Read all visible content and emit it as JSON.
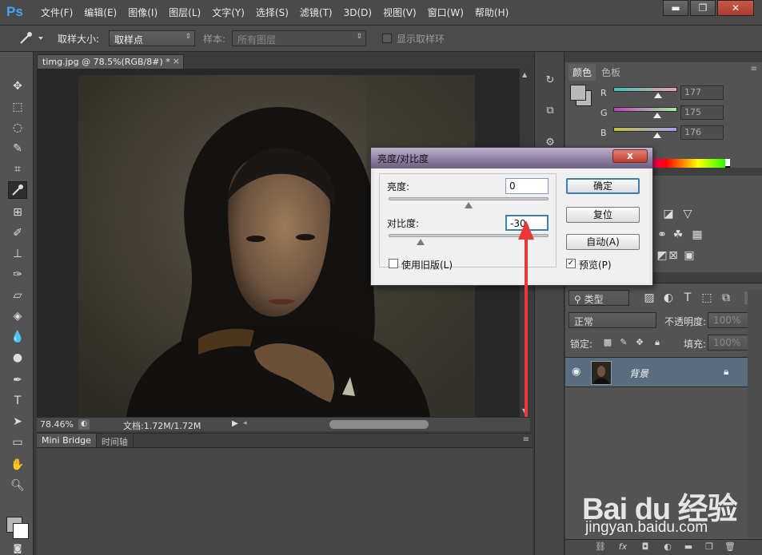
{
  "app": {
    "logo": "Ps",
    "menu": [
      "文件(F)",
      "编辑(E)",
      "图像(I)",
      "图层(L)",
      "文字(Y)",
      "选择(S)",
      "滤镜(T)",
      "3D(D)",
      "视图(V)",
      "窗口(W)",
      "帮助(H)"
    ],
    "window_buttons": [
      "▬",
      "❐",
      "✕"
    ]
  },
  "options_bar": {
    "sample_size_label": "取样大小:",
    "sample_size_value": "取样点",
    "sample_label": "样本:",
    "sample_value": "所有图层",
    "show_ring_label": "显示取样环"
  },
  "document": {
    "tab_title": "timg.jpg @ 78.5%(RGB/8#) *",
    "tab_close": "×",
    "zoom": "78.46%",
    "doc_info": "文档:1.72M/1.72M"
  },
  "bridge": {
    "tabs": [
      "Mini Bridge",
      "时间轴"
    ]
  },
  "color_panel": {
    "tabs": [
      "颜色",
      "色板"
    ],
    "channels": [
      {
        "label": "R",
        "value": "177",
        "gradient": [
          "#40c0c0",
          "#f0a0a0"
        ]
      },
      {
        "label": "G",
        "value": "175",
        "gradient": [
          "#c040c0",
          "#a0f0a0"
        ]
      },
      {
        "label": "B",
        "value": "176",
        "gradient": [
          "#c0c040",
          "#a0a0f0"
        ]
      }
    ]
  },
  "layers_panel": {
    "kind_label": "类型",
    "blend_mode": "正常",
    "opacity_label": "不透明度:",
    "opacity_value": "100%",
    "lock_label": "锁定:",
    "fill_label": "填充:",
    "fill_value": "100%",
    "layer_name": "背景"
  },
  "dialog": {
    "title": "亮度/对比度",
    "close": "x",
    "brightness_label": "亮度:",
    "brightness_value": "0",
    "contrast_label": "对比度:",
    "contrast_value": "-30",
    "use_legacy_label": "使用旧版(L)",
    "use_legacy_checked": false,
    "preview_label": "预览(P)",
    "preview_checked": true,
    "ok_label": "确定",
    "reset_label": "复位",
    "auto_label": "自动(A)",
    "brightness_slider_fraction": 0.5,
    "contrast_slider_fraction": 0.2
  },
  "watermark": {
    "logo": "Bai du 经验",
    "url": "jingyan.baidu.com"
  }
}
